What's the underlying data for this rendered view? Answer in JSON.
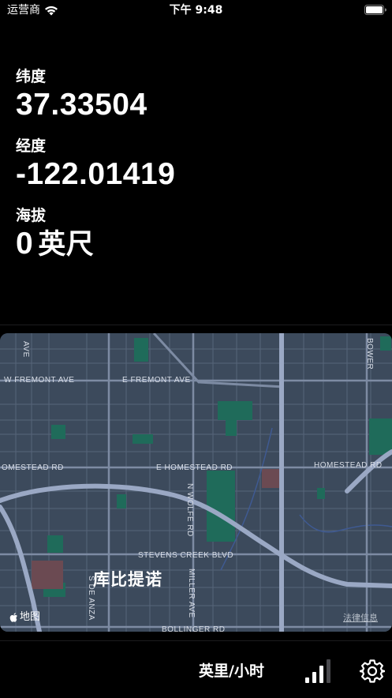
{
  "status_bar": {
    "carrier": "运营商",
    "time": "下午 9:48"
  },
  "location": {
    "latitude_label": "纬度",
    "latitude_value": "37.33504",
    "longitude_label": "经度",
    "longitude_value": "-122.01419",
    "altitude_label": "海拔",
    "altitude_value": "0",
    "altitude_unit": "英尺"
  },
  "map": {
    "brand": "地图",
    "legal": "法律信息",
    "city": "库比提诺",
    "streets": {
      "w_fremont": "W FREMONT AVE",
      "e_fremont": "E FREMONT AVE",
      "homestead_w": "OMESTEAD RD",
      "e_homestead": "E HOMESTEAD RD",
      "homestead_e": "HOMESTEAD RD",
      "stevens_creek": "STEVENS CREEK BLVD",
      "n_wolfe": "N WOLFE RD",
      "miller": "MILLER AVE",
      "s_de_anza": "S DE ANZA",
      "bollinger": "BOLLINGER RD",
      "bowers": "BOWER",
      "ave_left": "AVE"
    },
    "colors": {
      "background": "#3c4a5c",
      "park": "#1f6b5a",
      "highway": "#9aa8c4"
    }
  },
  "toolbar": {
    "speed_unit": "英里/小时"
  }
}
